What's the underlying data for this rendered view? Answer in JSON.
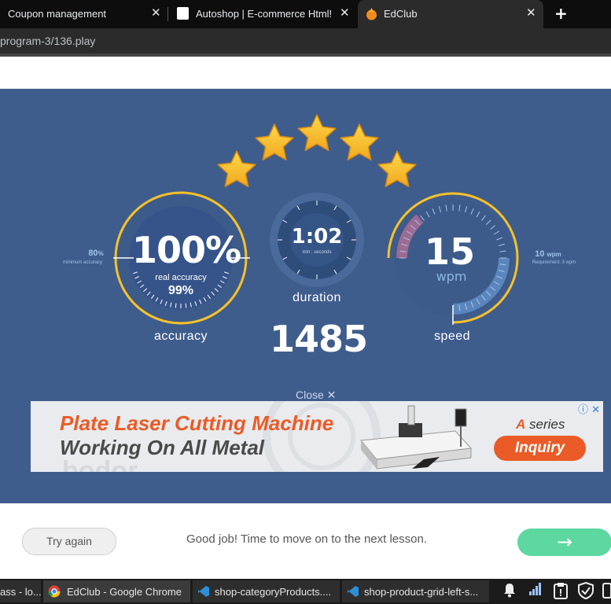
{
  "browser": {
    "tabs": [
      {
        "title": "Coupon management",
        "active": false
      },
      {
        "title": "Autoshop | E-commerce Html!",
        "active": false
      },
      {
        "title": "EdClub",
        "active": true
      }
    ],
    "close_glyph": "✕",
    "new_tab_glyph": "+",
    "url": "program-3/136.play"
  },
  "result": {
    "stars": 5,
    "accuracy": {
      "value": "100%",
      "real_label": "real accuracy",
      "real_value": "99%",
      "label": "accuracy",
      "minimum_value": "80",
      "minimum_unit": "%",
      "minimum_label": "minimum accuracy"
    },
    "duration": {
      "value": "1:02",
      "unit_label": "min : seconds",
      "label": "duration"
    },
    "score": "1485",
    "speed": {
      "value": "15",
      "unit": "wpm",
      "label": "speed",
      "requirement_value": "10",
      "requirement_unit": "wpm",
      "requirement_label": "Requirement: 3 wpm"
    },
    "close_ad": "Close ✕"
  },
  "ad": {
    "headline1": "Plate Laser Cutting Machine",
    "headline2": "Working On All Metal",
    "series_prefix": "A",
    "series_suffix": "series",
    "cta": "Inquiry",
    "brand": "bodor",
    "icons": "ⓘ ✕"
  },
  "actions": {
    "try_again": "Try again",
    "message": "Good job! Time to move on to the next lesson.",
    "next_arrow": "→"
  },
  "taskbar": {
    "items": [
      {
        "title": "ass - lo...",
        "active": false
      },
      {
        "title": "EdClub - Google Chrome",
        "active": true
      },
      {
        "title": "shop-categoryProducts....",
        "active": false
      },
      {
        "title": "shop-product-grid-left-s...",
        "active": false
      }
    ]
  },
  "colors": {
    "panel": "#3f5d8c",
    "gauge_ring": "#f6c229",
    "inner_dial": "#2f4d7b",
    "next_button": "#5dd8a0",
    "ad_accent": "#ea5b27"
  }
}
